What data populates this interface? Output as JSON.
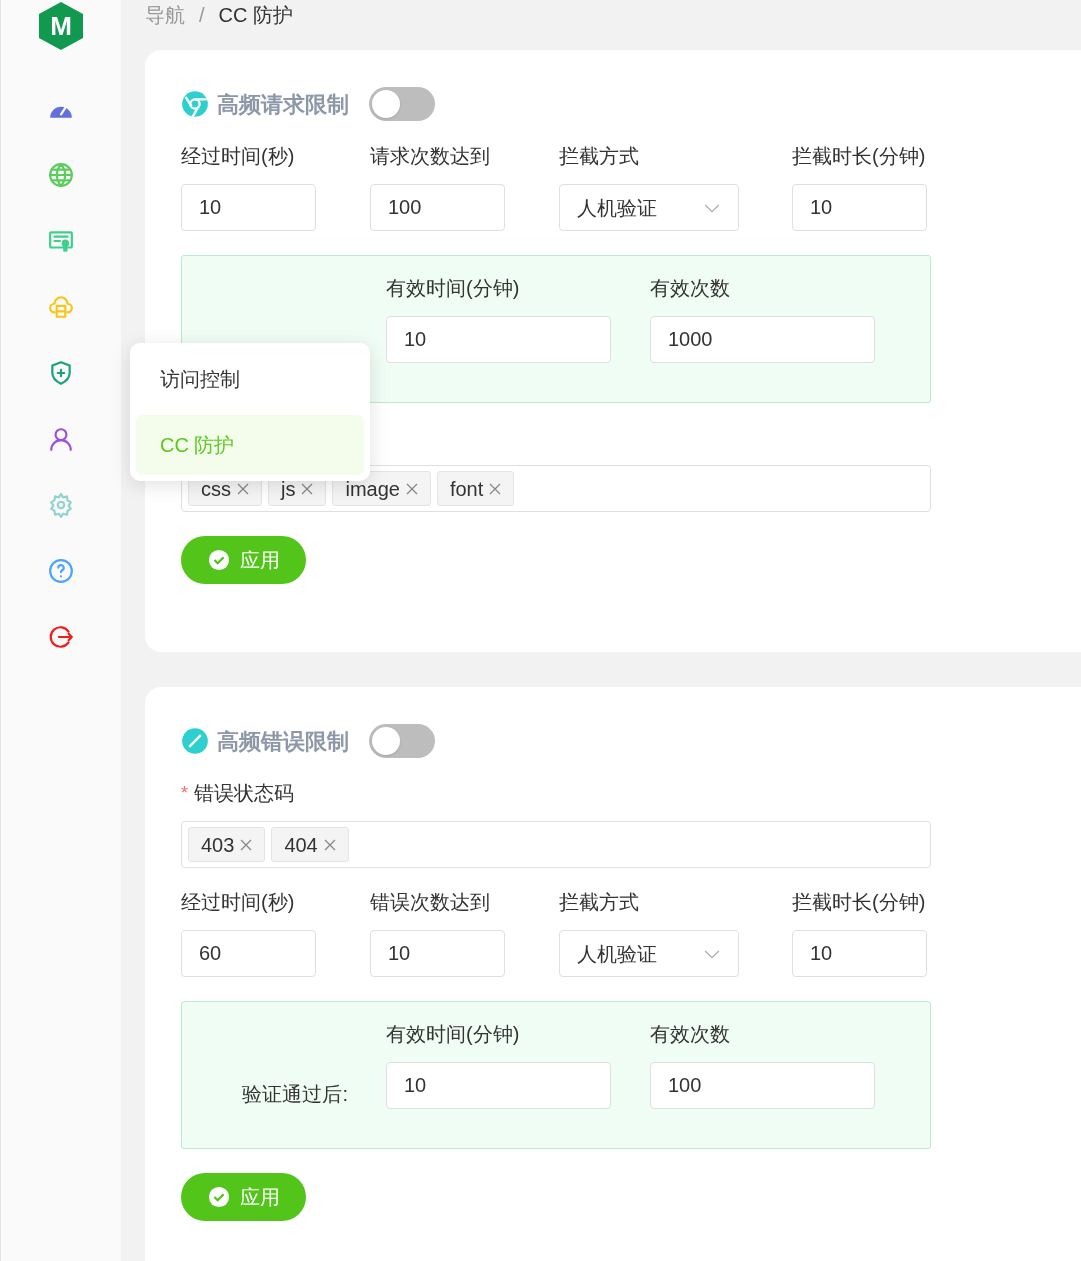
{
  "logo": {
    "text": "M"
  },
  "sidebar": {
    "items": [
      {
        "kind": "dashboard"
      },
      {
        "kind": "globe"
      },
      {
        "kind": "certificate"
      },
      {
        "kind": "cloud"
      },
      {
        "kind": "shield"
      },
      {
        "kind": "user"
      },
      {
        "kind": "settings"
      },
      {
        "kind": "help"
      },
      {
        "kind": "logout"
      }
    ]
  },
  "breadcrumb": {
    "items": [
      "导航",
      "CC 防护"
    ],
    "separator": "/"
  },
  "menu": {
    "items": [
      {
        "label": "访问控制",
        "selected": false
      },
      {
        "label": "CC 防护",
        "selected": true
      }
    ]
  },
  "sections": [
    {
      "kind": "chrome",
      "title": "高频请求限制",
      "on": false,
      "blocks": [
        {
          "kind": "fields",
          "fields": [
            {
              "label": "经过时间(秒)",
              "value": "10",
              "kind": "input"
            },
            {
              "label": "请求次数达到",
              "value": "100",
              "kind": "input"
            },
            {
              "label": "拦截方式",
              "value": "人机验证",
              "kind": "select"
            },
            {
              "label": "拦截时长(分钟)",
              "value": "10",
              "kind": "input"
            }
          ]
        },
        {
          "kind": "verify",
          "fields": [
            {
              "label": "有效时间(分钟)",
              "value": "10"
            },
            {
              "label": "有效次数",
              "value": "1000"
            }
          ]
        },
        {
          "kind": "tags",
          "tags": [
            "css",
            "js",
            "image",
            "font"
          ]
        }
      ],
      "button": "应用"
    },
    {
      "kind": "slash",
      "title": "高频错误限制",
      "on": false,
      "blocks": [
        {
          "kind": "tags",
          "label": "错误状态码",
          "required": true,
          "required_mark": "*",
          "tags": [
            "403",
            "404"
          ]
        },
        {
          "kind": "fields",
          "fields": [
            {
              "label": "经过时间(秒)",
              "value": "60",
              "kind": "input"
            },
            {
              "label": "错误次数达到",
              "value": "10",
              "kind": "input"
            },
            {
              "label": "拦截方式",
              "value": "人机验证",
              "kind": "select"
            },
            {
              "label": "拦截时长(分钟)",
              "value": "10",
              "kind": "input"
            }
          ]
        },
        {
          "kind": "verify",
          "label": "验证通过后:",
          "fields": [
            {
              "label": "有效时间(分钟)",
              "value": "10"
            },
            {
              "label": "有效次数",
              "value": "100"
            }
          ]
        }
      ],
      "button": "应用"
    }
  ]
}
